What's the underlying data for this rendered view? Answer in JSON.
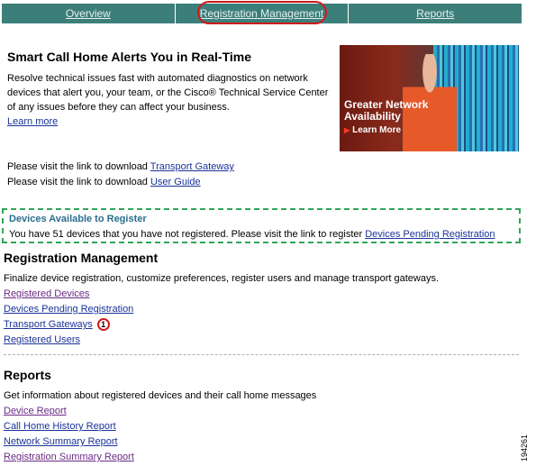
{
  "nav": {
    "tabs": [
      "Overview",
      "Registration Management",
      "Reports"
    ]
  },
  "hero": {
    "title": "Smart Call Home Alerts You in Real-Time",
    "description": "Resolve technical issues fast with automated diagnostics on network devices that alert you, your team, or the Cisco® Technical Service Center of any issues before they can affect your business.",
    "learn_more": "Learn more",
    "image_banner": "Greater Network Availability",
    "image_link": "Learn More"
  },
  "downloads": [
    {
      "text": "Please visit the link to download ",
      "link": "Transport Gateway"
    },
    {
      "text": "Please visit the link to download ",
      "link": "User Guide"
    }
  ],
  "available": {
    "title": "Devices Available to Register",
    "text": "You have 51 devices that you have not registered. Please visit the link to register ",
    "link": "Devices Pending Registration"
  },
  "registration": {
    "title": "Registration Management",
    "description": "Finalize device registration, customize preferences, register users and manage transport gateways.",
    "links": [
      "Registered Devices",
      "Devices Pending Registration",
      "Transport Gateways",
      "Registered Users"
    ],
    "callout": "1"
  },
  "reports": {
    "title": "Reports",
    "description": "Get information about registered devices and their call home messages",
    "links": [
      "Device Report",
      "Call Home History Report",
      "Network Summary Report",
      "Registration Summary Report"
    ]
  },
  "figure_number": "194261",
  "colors": {
    "nav_bg": "#3c7f7a",
    "highlight_red": "#d01a1a",
    "box_green": "#2fa55a",
    "link_blue": "#1a3399",
    "link_visited": "#6a2a86"
  }
}
